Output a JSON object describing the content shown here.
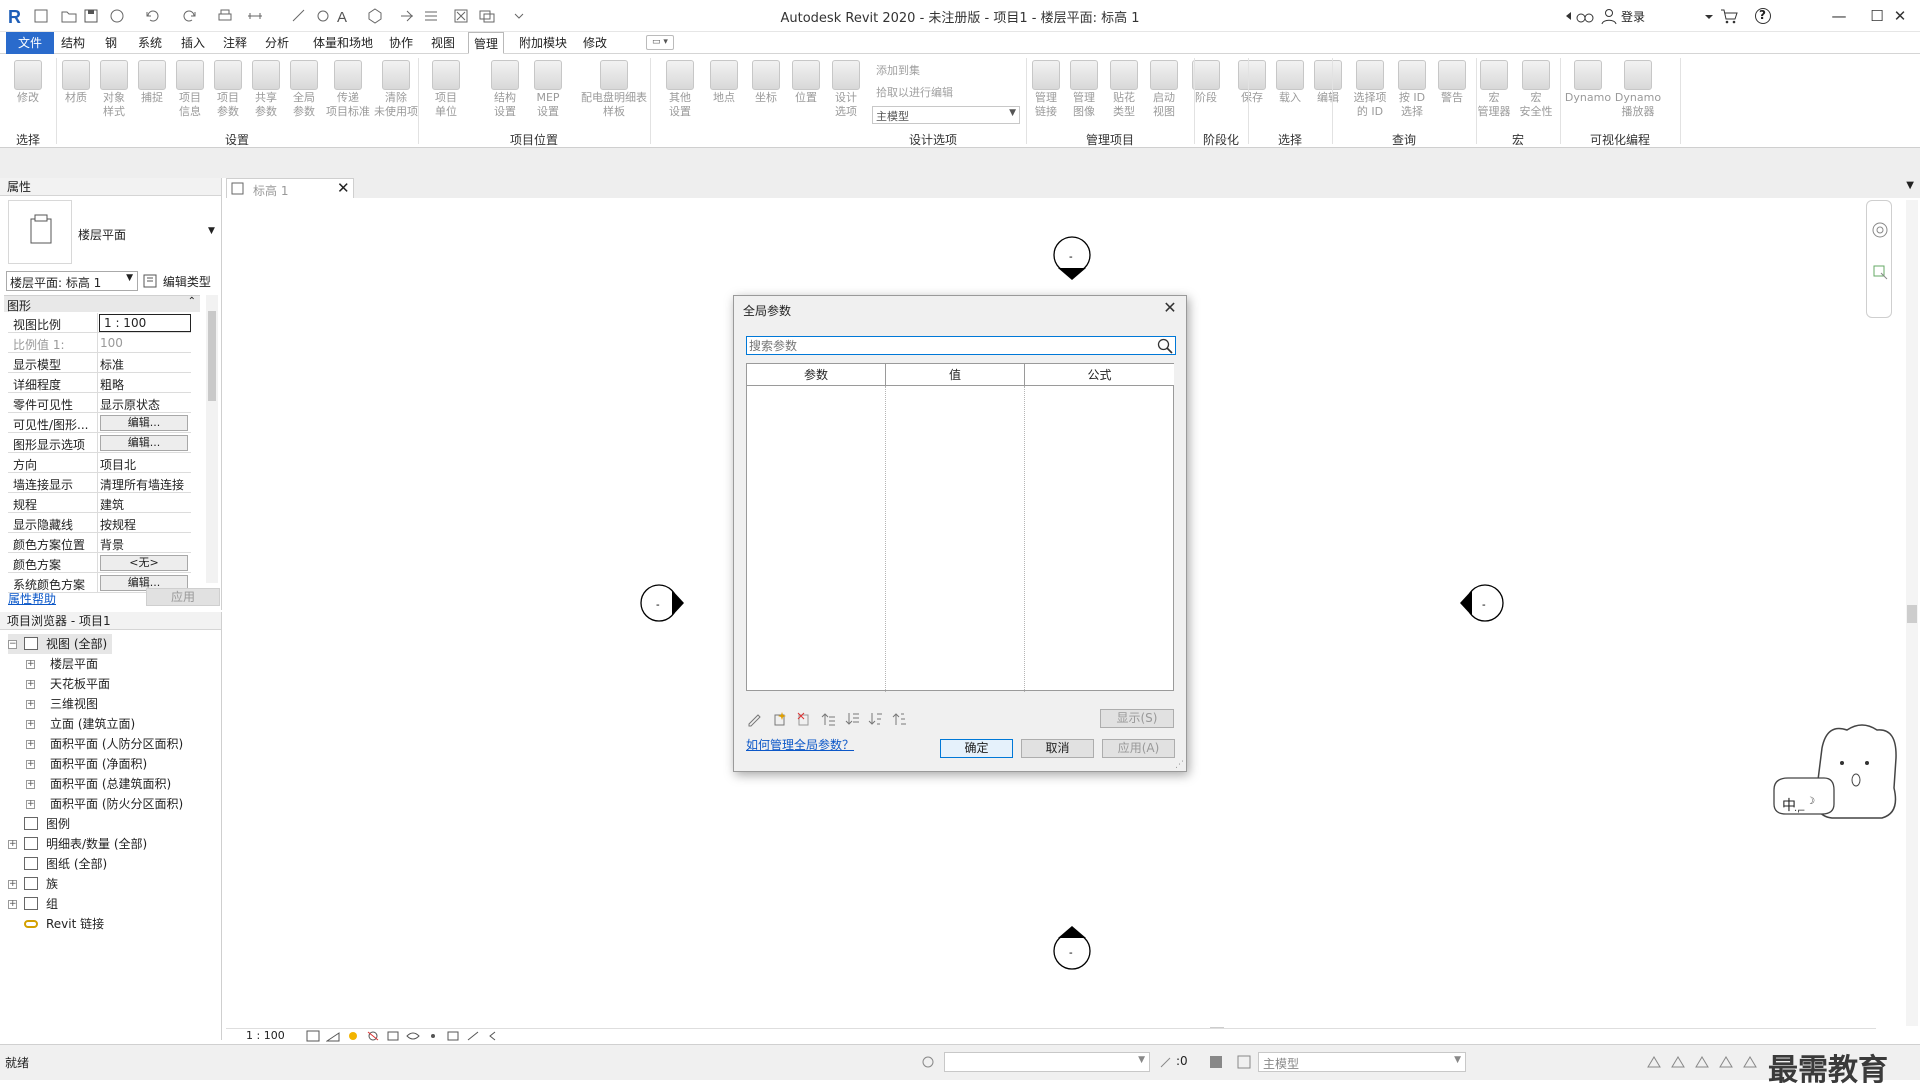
{
  "app": {
    "title": "Autodesk Revit 2020 - 未注册版 - 项目1 - 楼层平面: 标高 1",
    "login": "登录",
    "help_glyph": "?",
    "minimize": "—",
    "maximize": "☐",
    "close": "✕"
  },
  "menu": {
    "items": [
      "文件",
      "结构",
      "钢",
      "系统",
      "插入",
      "注释",
      "分析",
      "体量和场地",
      "协作",
      "视图",
      "管理",
      "附加模块",
      "修改"
    ],
    "active": "管理"
  },
  "ribbon": {
    "buttons": [
      "修改",
      "材质",
      "对象\n样式",
      "捕捉",
      "项目\n信息",
      "项目\n参数",
      "共享\n参数",
      "全局\n参数",
      "传递\n项目标准",
      "清除\n未使用项",
      "项目\n单位",
      "结构\n设置",
      "MEP\n设置",
      "配电盘明细表\n样板",
      "其他\n设置",
      "地点",
      "坐标",
      "位置",
      "设计\n选项",
      "管理\n链接",
      "管理\n图像",
      "贴花\n类型",
      "启动\n视图",
      "阶段",
      "保存",
      "载入",
      "编辑",
      "选择项\n的 ID",
      "按 ID\n选择",
      "警告",
      "宏\n管理器",
      "宏\n安全性",
      "Dynamo",
      "Dynamo\n播放器"
    ],
    "design_options": {
      "add_to_set": "添加到集",
      "pick_to_edit": "拾取以进行编辑",
      "main_model": "主模型"
    },
    "groups": [
      "选择",
      "设置",
      "项目位置",
      "设计选项",
      "管理项目",
      "阶段化",
      "选择",
      "查询",
      "宏",
      "可视化编程"
    ]
  },
  "properties": {
    "title": "属性",
    "type_name": "楼层平面",
    "instance_selector": "楼层平面: 标高 1",
    "edit_type": "编辑类型",
    "section": "图形",
    "rows": [
      {
        "k": "视图比例",
        "v": "1 : 100"
      },
      {
        "k": "比例值 1:",
        "v": "100"
      },
      {
        "k": "显示模型",
        "v": "标准"
      },
      {
        "k": "详细程度",
        "v": "粗略"
      },
      {
        "k": "零件可见性",
        "v": "显示原状态"
      },
      {
        "k": "可见性/图形...",
        "v": "编辑..."
      },
      {
        "k": "图形显示选项",
        "v": "编辑..."
      },
      {
        "k": "方向",
        "v": "项目北"
      },
      {
        "k": "墙连接显示",
        "v": "清理所有墙连接"
      },
      {
        "k": "规程",
        "v": "建筑"
      },
      {
        "k": "显示隐藏线",
        "v": "按规程"
      },
      {
        "k": "颜色方案位置",
        "v": "背景"
      },
      {
        "k": "颜色方案",
        "v": "<无>"
      },
      {
        "k": "系统颜色方案",
        "v": "编辑..."
      }
    ],
    "help_link": "属性帮助",
    "apply": "应用"
  },
  "browser": {
    "title": "项目浏览器 - 项目1",
    "items": [
      {
        "label": "视图 (全部)",
        "level": 0
      },
      {
        "label": "楼层平面",
        "level": 1
      },
      {
        "label": "天花板平面",
        "level": 1
      },
      {
        "label": "三维视图",
        "level": 1
      },
      {
        "label": "立面 (建筑立面)",
        "level": 1
      },
      {
        "label": "面积平面 (人防分区面积)",
        "level": 1
      },
      {
        "label": "面积平面 (净面积)",
        "level": 1
      },
      {
        "label": "面积平面 (总建筑面积)",
        "level": 1
      },
      {
        "label": "面积平面 (防火分区面积)",
        "level": 1
      },
      {
        "label": "图例",
        "level": 0
      },
      {
        "label": "明细表/数量 (全部)",
        "level": 0
      },
      {
        "label": "图纸 (全部)",
        "level": 0
      },
      {
        "label": "族",
        "level": 0
      },
      {
        "label": "组",
        "level": 0
      },
      {
        "label": "Revit 链接",
        "level": 0
      }
    ]
  },
  "view_tab": {
    "label": "标高 1"
  },
  "dialog": {
    "title": "全局参数",
    "search_placeholder": "搜索参数",
    "columns": [
      "参数",
      "值",
      "公式"
    ],
    "show_button": "显示(S)",
    "help_link": "如何管理全局参数？",
    "ok": "确定",
    "cancel": "取消",
    "apply": "应用(A)"
  },
  "view_control": {
    "scale": "1 : 100"
  },
  "status": {
    "text": "就绪",
    "zero": ":0",
    "model": "主模型"
  },
  "watermark": "最需教育",
  "ime": "中"
}
